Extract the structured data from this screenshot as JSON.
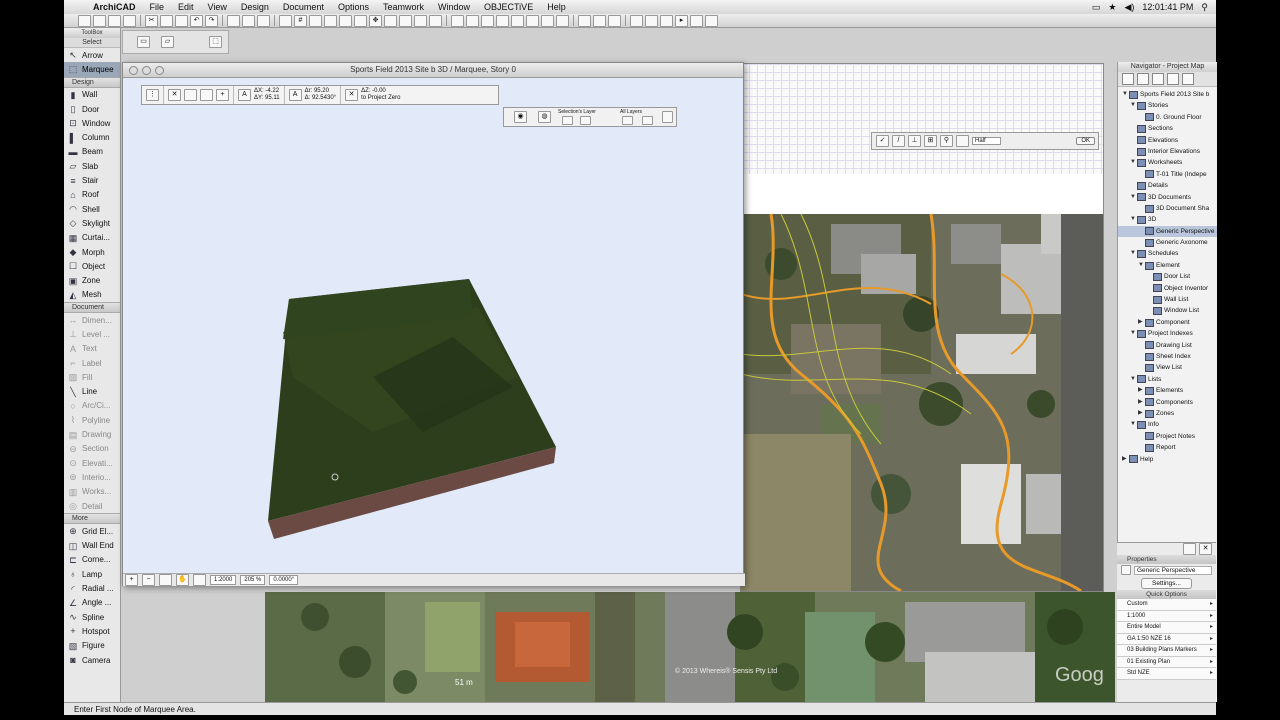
{
  "menubar": {
    "app": "ArchiCAD",
    "items": [
      "File",
      "Edit",
      "View",
      "Design",
      "Document",
      "Options",
      "Teamwork",
      "Window",
      "OBJECTiVE",
      "Help"
    ],
    "clock": "12:01:41 PM"
  },
  "toolbox": {
    "title": "ToolBox",
    "select_label": "Select",
    "select_tools": [
      {
        "label": "Arrow",
        "icon": "arrow-icon"
      },
      {
        "label": "Marquee",
        "icon": "marquee-icon",
        "active": true
      }
    ],
    "design_header": "Design",
    "design_tools": [
      {
        "label": "Wall",
        "icon": "wall-icon"
      },
      {
        "label": "Door",
        "icon": "door-icon"
      },
      {
        "label": "Window",
        "icon": "window-icon"
      },
      {
        "label": "Column",
        "icon": "column-icon"
      },
      {
        "label": "Beam",
        "icon": "beam-icon"
      },
      {
        "label": "Slab",
        "icon": "slab-icon"
      },
      {
        "label": "Stair",
        "icon": "stair-icon"
      },
      {
        "label": "Roof",
        "icon": "roof-icon"
      },
      {
        "label": "Shell",
        "icon": "shell-icon"
      },
      {
        "label": "Skylight",
        "icon": "skylight-icon"
      },
      {
        "label": "Curtai...",
        "icon": "curtain-wall-icon"
      },
      {
        "label": "Morph",
        "icon": "morph-icon"
      },
      {
        "label": "Object",
        "icon": "object-icon"
      },
      {
        "label": "Zone",
        "icon": "zone-icon"
      },
      {
        "label": "Mesh",
        "icon": "mesh-icon"
      }
    ],
    "document_header": "Document",
    "document_tools": [
      {
        "label": "Dimen...",
        "icon": "dimension-icon"
      },
      {
        "label": "Level ...",
        "icon": "level-dimension-icon"
      },
      {
        "label": "Text",
        "icon": "text-icon"
      },
      {
        "label": "Label",
        "icon": "label-icon"
      },
      {
        "label": "Fill",
        "icon": "fill-icon"
      },
      {
        "label": "Line",
        "icon": "line-icon"
      },
      {
        "label": "Arc/Ci...",
        "icon": "arc-icon"
      },
      {
        "label": "Polyline",
        "icon": "polyline-icon"
      },
      {
        "label": "Drawing",
        "icon": "drawing-icon"
      },
      {
        "label": "Section",
        "icon": "section-icon"
      },
      {
        "label": "Elevati...",
        "icon": "elevation-icon"
      },
      {
        "label": "Interio...",
        "icon": "interior-elevation-icon"
      },
      {
        "label": "Works...",
        "icon": "worksheet-icon"
      },
      {
        "label": "Detail",
        "icon": "detail-icon"
      }
    ],
    "more_header": "More",
    "more_tools": [
      {
        "label": "Grid El...",
        "icon": "grid-element-icon"
      },
      {
        "label": "Wall End",
        "icon": "wall-end-icon"
      },
      {
        "label": "Corne...",
        "icon": "corner-window-icon"
      },
      {
        "label": "Lamp",
        "icon": "lamp-icon"
      },
      {
        "label": "Radial ...",
        "icon": "radial-dimension-icon"
      },
      {
        "label": "Angle ...",
        "icon": "angle-dimension-icon"
      },
      {
        "label": "Spline",
        "icon": "spline-icon"
      },
      {
        "label": "Hotspot",
        "icon": "hotspot-icon"
      },
      {
        "label": "Figure",
        "icon": "figure-icon"
      },
      {
        "label": "Camera",
        "icon": "camera-icon"
      }
    ]
  },
  "window3d": {
    "title": "Sports Field 2013 Site b 3D / Marquee, Story 0",
    "infobox": {
      "dx_label": "ΔX:",
      "dx": "-4.22",
      "dy_label": "ΔY:",
      "dy": "95.11",
      "dr_label": "Δr:",
      "dr": "95.20",
      "da_label": "Δ:",
      "da": "92.5430°",
      "dz_label": "ΔZ:",
      "dz": "-0.00",
      "dz_ref": "to Project Zero"
    },
    "layers": {
      "selection": "Selection's Layer",
      "all": "All Layers"
    },
    "statusrow": {
      "scale": "1:2000",
      "zoom": "205 %",
      "angle": "0.0000°"
    }
  },
  "planwin": {
    "snap_label": "Half",
    "ok": "OK"
  },
  "navigator": {
    "title": "Navigator - Project Map",
    "tree": [
      {
        "label": "Sports Field 2013 Site b",
        "level": 0,
        "tri": "▼"
      },
      {
        "label": "Stories",
        "level": 1,
        "tri": "▼"
      },
      {
        "label": "0. Ground Floor",
        "level": 2,
        "tri": ""
      },
      {
        "label": "Sections",
        "level": 1,
        "tri": ""
      },
      {
        "label": "Elevations",
        "level": 1,
        "tri": ""
      },
      {
        "label": "Interior Elevations",
        "level": 1,
        "tri": ""
      },
      {
        "label": "Worksheets",
        "level": 1,
        "tri": "▼"
      },
      {
        "label": "T-01 Title (Indepe",
        "level": 2,
        "tri": ""
      },
      {
        "label": "Details",
        "level": 1,
        "tri": ""
      },
      {
        "label": "3D Documents",
        "level": 1,
        "tri": "▼"
      },
      {
        "label": "3D Document Sha",
        "level": 2,
        "tri": ""
      },
      {
        "label": "3D",
        "level": 1,
        "tri": "▼"
      },
      {
        "label": "Generic Perspective",
        "level": 2,
        "tri": "",
        "sel": true
      },
      {
        "label": "Generic Axonome",
        "level": 2,
        "tri": ""
      },
      {
        "label": "Schedules",
        "level": 1,
        "tri": "▼"
      },
      {
        "label": "Element",
        "level": 2,
        "tri": "▼"
      },
      {
        "label": "Door List",
        "level": 3,
        "tri": ""
      },
      {
        "label": "Object Inventor",
        "level": 3,
        "tri": ""
      },
      {
        "label": "Wall List",
        "level": 3,
        "tri": ""
      },
      {
        "label": "Window List",
        "level": 3,
        "tri": ""
      },
      {
        "label": "Component",
        "level": 2,
        "tri": "▶"
      },
      {
        "label": "Project Indexes",
        "level": 1,
        "tri": "▼"
      },
      {
        "label": "Drawing List",
        "level": 2,
        "tri": ""
      },
      {
        "label": "Sheet Index",
        "level": 2,
        "tri": ""
      },
      {
        "label": "View List",
        "level": 2,
        "tri": ""
      },
      {
        "label": "Lists",
        "level": 1,
        "tri": "▼"
      },
      {
        "label": "Elements",
        "level": 2,
        "tri": "▶"
      },
      {
        "label": "Components",
        "level": 2,
        "tri": "▶"
      },
      {
        "label": "Zones",
        "level": 2,
        "tri": "▶"
      },
      {
        "label": "Info",
        "level": 1,
        "tri": "▼"
      },
      {
        "label": "Project Notes",
        "level": 2,
        "tri": ""
      },
      {
        "label": "Report",
        "level": 2,
        "tri": ""
      },
      {
        "label": "Help",
        "level": 0,
        "tri": "▶"
      }
    ],
    "properties_header": "Properties",
    "properties_value": "Generic Perspective",
    "settings_label": "Settings...",
    "quick_options_header": "Quick Options",
    "quick_options": [
      "Custom",
      "1:1000",
      "Entire Model",
      "GA 1:50 NZE 16",
      "03 Building Plans Markers",
      "01 Existing Plan",
      "Std NZE"
    ]
  },
  "map": {
    "scale": "51 m",
    "copyright": "© 2013 Whereis® Sensis Pty Ltd"
  },
  "status": "Enter First Node of Marquee Area."
}
